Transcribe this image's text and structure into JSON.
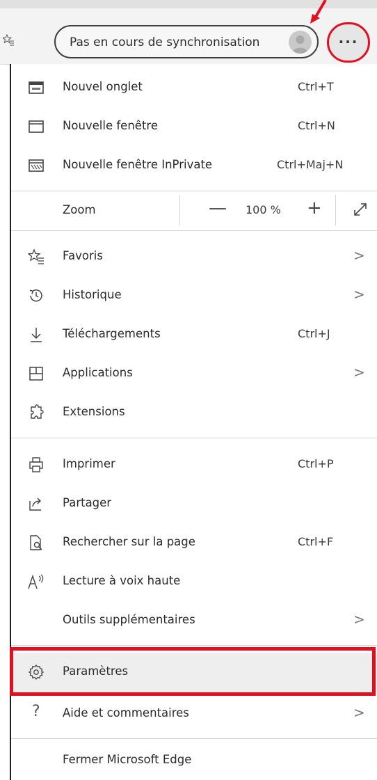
{
  "toolbar": {
    "sync_label": "Pas en cours de synchronisation",
    "more_label": "···",
    "favorites_list_icon": "favorites-list-icon",
    "avatar_icon": "avatar-icon",
    "highlight_color": "#e10f1f"
  },
  "menu": {
    "new_tab": {
      "label": "Nouvel onglet",
      "shortcut": "Ctrl+T"
    },
    "new_window": {
      "label": "Nouvelle fenêtre",
      "shortcut": "Ctrl+N"
    },
    "new_inprivate": {
      "label": "Nouvelle fenêtre InPrivate",
      "shortcut": "Ctrl+Maj+N"
    },
    "zoom": {
      "label": "Zoom",
      "minus": "—",
      "value": "100 %",
      "plus": "+"
    },
    "favorites": {
      "label": "Favoris",
      "chevron": ">"
    },
    "history": {
      "label": "Historique",
      "chevron": ">"
    },
    "downloads": {
      "label": "Téléchargements",
      "shortcut": "Ctrl+J"
    },
    "apps": {
      "label": "Applications",
      "chevron": ">"
    },
    "extensions": {
      "label": "Extensions"
    },
    "print": {
      "label": "Imprimer",
      "shortcut": "Ctrl+P"
    },
    "share": {
      "label": "Partager"
    },
    "find": {
      "label": "Rechercher sur la page",
      "shortcut": "Ctrl+F"
    },
    "read_aloud": {
      "label": "Lecture à voix haute"
    },
    "more_tools": {
      "label": "Outils supplémentaires",
      "chevron": ">"
    },
    "settings": {
      "label": "Paramètres"
    },
    "help": {
      "label": "Aide et commentaires",
      "chevron": ">"
    },
    "close": {
      "label": "Fermer Microsoft Edge"
    }
  }
}
